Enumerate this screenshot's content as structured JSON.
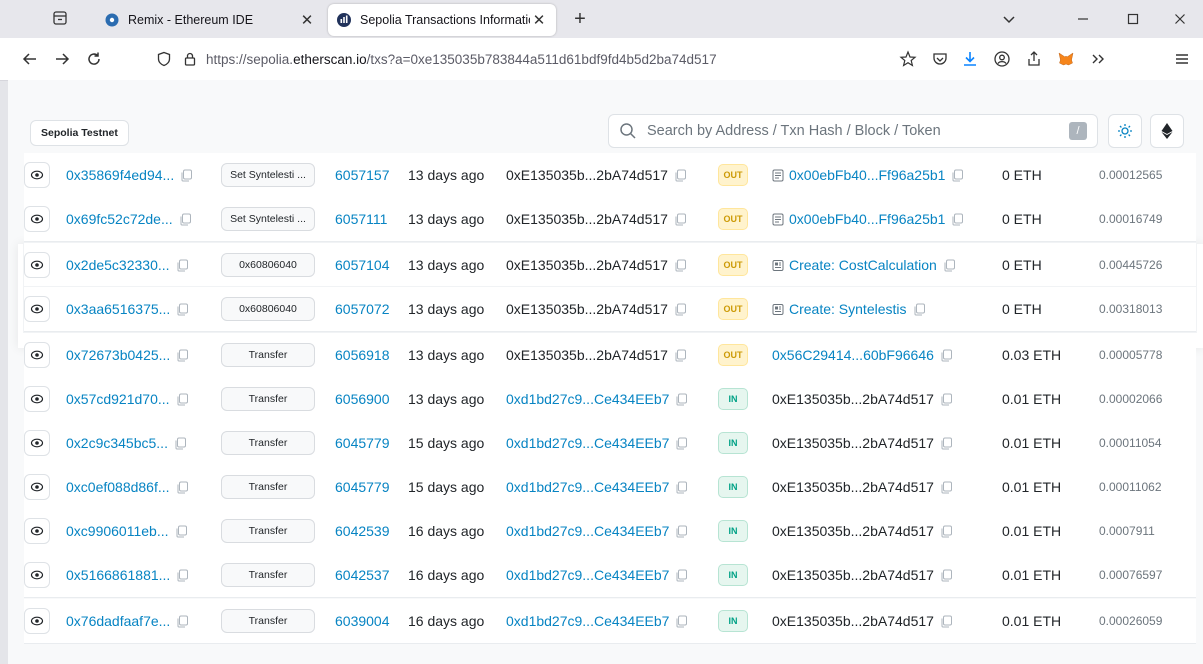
{
  "browser": {
    "tabs": [
      {
        "title": "Remix - Ethereum IDE",
        "active": false,
        "favicon": "remix-icon"
      },
      {
        "title": "Sepolia Transactions Informatio",
        "active": true,
        "favicon": "etherscan-icon"
      }
    ],
    "url": {
      "prefix": "https://sepolia.",
      "host": "etherscan.io",
      "path": "/txs?a=0xe135035b783844a511d61bdf9fd4b5d2ba74d517"
    }
  },
  "site": {
    "network_badge": "Sepolia Testnet",
    "search_placeholder": "Search by Address / Txn Hash / Block / Token",
    "search_shortcut": "/"
  },
  "colors": {
    "link": "#0784c3",
    "out": "#cc9a06",
    "in": "#00a186"
  },
  "transactions": [
    {
      "hash": "0x35869f4ed94...",
      "method": "Set Syntelesti ...",
      "block": "6057157",
      "age": "13 days ago",
      "from": "0xE135035b...2bA74d517",
      "from_link": false,
      "dir": "OUT",
      "to": "0x00ebFb40...Ff96a25b1",
      "to_link": true,
      "to_icon": "contract-icon",
      "value": "0 ETH",
      "fee": "0.00012565"
    },
    {
      "hash": "0x69fc52c72de...",
      "method": "Set Syntelesti ...",
      "block": "6057111",
      "age": "13 days ago",
      "from": "0xE135035b...2bA74d517",
      "from_link": false,
      "dir": "OUT",
      "to": "0x00ebFb40...Ff96a25b1",
      "to_link": true,
      "to_icon": "contract-icon",
      "value": "0 ETH",
      "fee": "0.00016749"
    },
    {
      "hash": "0x2de5c32330...",
      "method": "0x60806040",
      "block": "6057104",
      "age": "13 days ago",
      "from": "0xE135035b...2bA74d517",
      "from_link": false,
      "dir": "OUT",
      "to": "Create: CostCalculation",
      "to_link": true,
      "to_icon": "create-icon",
      "value": "0 ETH",
      "fee": "0.00445726"
    },
    {
      "hash": "0x3aa6516375...",
      "method": "0x60806040",
      "block": "6057072",
      "age": "13 days ago",
      "from": "0xE135035b...2bA74d517",
      "from_link": false,
      "dir": "OUT",
      "to": "Create: Syntelestis",
      "to_link": true,
      "to_icon": "create-icon",
      "value": "0 ETH",
      "fee": "0.00318013"
    },
    {
      "hash": "0x72673b0425...",
      "method": "Transfer",
      "block": "6056918",
      "age": "13 days ago",
      "from": "0xE135035b...2bA74d517",
      "from_link": false,
      "dir": "OUT",
      "to": "0x56C29414...60bF96646",
      "to_link": true,
      "to_icon": "",
      "value": "0.03 ETH",
      "fee": "0.00005778"
    },
    {
      "hash": "0x57cd921d70...",
      "method": "Transfer",
      "block": "6056900",
      "age": "13 days ago",
      "from": "0xd1bd27c9...Ce434EEb7",
      "from_link": true,
      "dir": "IN",
      "to": "0xE135035b...2bA74d517",
      "to_link": false,
      "to_icon": "",
      "value": "0.01 ETH",
      "fee": "0.00002066"
    },
    {
      "hash": "0x2c9c345bc5...",
      "method": "Transfer",
      "block": "6045779",
      "age": "15 days ago",
      "from": "0xd1bd27c9...Ce434EEb7",
      "from_link": true,
      "dir": "IN",
      "to": "0xE135035b...2bA74d517",
      "to_link": false,
      "to_icon": "",
      "value": "0.01 ETH",
      "fee": "0.00011054"
    },
    {
      "hash": "0xc0ef088d86f...",
      "method": "Transfer",
      "block": "6045779",
      "age": "15 days ago",
      "from": "0xd1bd27c9...Ce434EEb7",
      "from_link": true,
      "dir": "IN",
      "to": "0xE135035b...2bA74d517",
      "to_link": false,
      "to_icon": "",
      "value": "0.01 ETH",
      "fee": "0.00011062"
    },
    {
      "hash": "0xc9906011eb...",
      "method": "Transfer",
      "block": "6042539",
      "age": "16 days ago",
      "from": "0xd1bd27c9...Ce434EEb7",
      "from_link": true,
      "dir": "IN",
      "to": "0xE135035b...2bA74d517",
      "to_link": false,
      "to_icon": "",
      "value": "0.01 ETH",
      "fee": "0.0007911"
    },
    {
      "hash": "0x5166861881...",
      "method": "Transfer",
      "block": "6042537",
      "age": "16 days ago",
      "from": "0xd1bd27c9...Ce434EEb7",
      "from_link": true,
      "dir": "IN",
      "to": "0xE135035b...2bA74d517",
      "to_link": false,
      "to_icon": "",
      "value": "0.01 ETH",
      "fee": "0.00076597"
    },
    {
      "hash": "0x76dadfaaf7e...",
      "method": "Transfer",
      "block": "6039004",
      "age": "16 days ago",
      "from": "0xd1bd27c9...Ce434EEb7",
      "from_link": true,
      "dir": "IN",
      "to": "0xE135035b...2bA74d517",
      "to_link": false,
      "to_icon": "",
      "value": "0.01 ETH",
      "fee": "0.00026059"
    }
  ]
}
